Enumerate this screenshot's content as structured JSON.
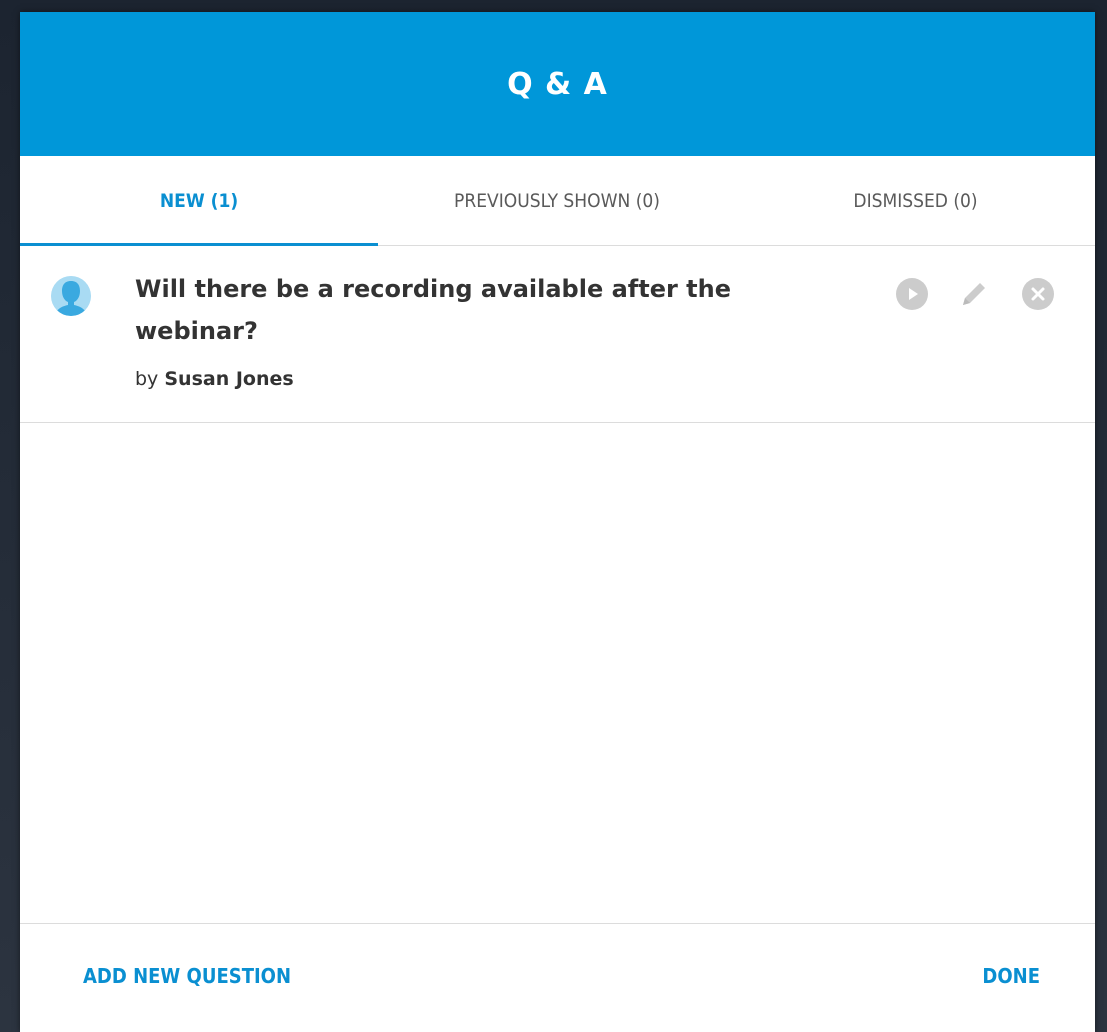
{
  "dialog": {
    "title": "Q & A"
  },
  "tabs": [
    {
      "label": "NEW (1)",
      "active": true
    },
    {
      "label": "PREVIOUSLY SHOWN (0)",
      "active": false
    },
    {
      "label": "DISMISSED (0)",
      "active": false
    }
  ],
  "questions": [
    {
      "text": "Will there be a recording available after the webinar?",
      "author_prefix": "by",
      "author": "Susan Jones",
      "actions": [
        "play-icon",
        "edit-icon",
        "dismiss-icon"
      ]
    }
  ],
  "footer": {
    "add_label": "ADD NEW QUESTION",
    "done_label": "DONE"
  },
  "colors": {
    "accent": "#0097d9",
    "link": "#0a8fd1",
    "icon_gray": "#cccccc"
  }
}
